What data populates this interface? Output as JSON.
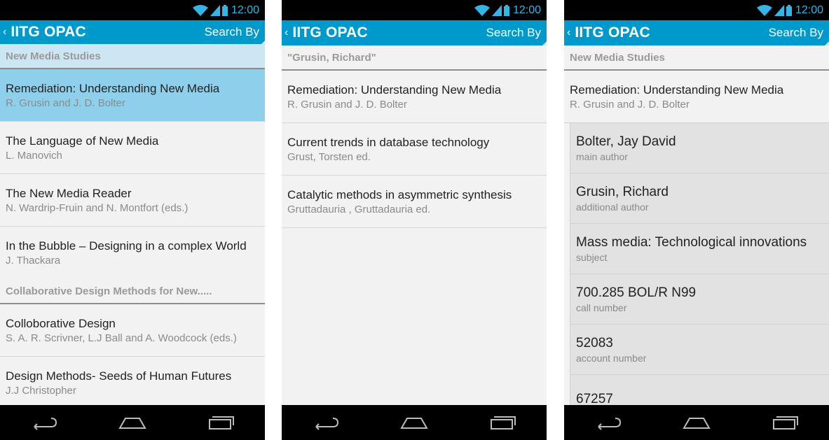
{
  "status": {
    "time": "12:00"
  },
  "colors": {
    "action_bar": "#0099cc",
    "status_icon": "#33b5e5",
    "selected": "#8ed0ec",
    "section_blue": "#cce7f3"
  },
  "icons": [
    "wifi-icon",
    "signal-icon",
    "battery-icon",
    "back-nav-icon",
    "home-nav-icon",
    "recents-nav-icon"
  ],
  "screens": [
    {
      "app_title": "IITG OPAC",
      "search_label": "Search By",
      "up_glyph": "‹",
      "sections": [
        {
          "header": "New Media Studies",
          "items": [
            {
              "title": "Remediation: Understanding New Media",
              "subtitle": "R. Grusin and J. D. Bolter"
            },
            {
              "title": "The Language of New Media",
              "subtitle": "L. Manovich"
            },
            {
              "title": "The New Media Reader",
              "subtitle": "N. Wardrip-Fruin and N. Montfort (eds.)"
            },
            {
              "title": "In the Bubble – Designing in a complex World",
              "subtitle": "J. Thackara"
            }
          ]
        },
        {
          "header": "Collaborative Design Methods for New.....",
          "items": [
            {
              "title": "Colloborative Design",
              "subtitle": "S. A. R. Scrivner, L.J Ball and A. Woodcock (eds.)"
            },
            {
              "title": "Design Methods- Seeds of Human Futures",
              "subtitle": "J.J Christopher"
            }
          ]
        }
      ]
    },
    {
      "app_title": "IITG OPAC",
      "search_label": "Search By",
      "up_glyph": "‹",
      "header": "\"Grusin, Richard\"",
      "items": [
        {
          "title": "Remediation: Understanding New Media",
          "subtitle": "R. Grusin and J. D. Bolter"
        },
        {
          "title": "Current trends in database technology",
          "subtitle": "Grust, Torsten ed."
        },
        {
          "title": "Catalytic methods in asymmetric synthesis",
          "subtitle": "Gruttadauria , Gruttadauria ed."
        }
      ]
    },
    {
      "app_title": "IITG OPAC",
      "search_label": "Search By",
      "up_glyph": "‹",
      "header": "New Media Studies",
      "book": {
        "title": "Remediation: Understanding New Media",
        "subtitle": "R. Grusin and J. D. Bolter"
      },
      "details": [
        {
          "value": "Bolter, Jay David",
          "label": "main author"
        },
        {
          "value": "Grusin, Richard",
          "label": "additional author"
        },
        {
          "value": "Mass media: Technological innovations",
          "label": "subject"
        },
        {
          "value": "700.285 BOL/R N99",
          "label": "call number"
        },
        {
          "value": "52083",
          "label": "account number"
        },
        {
          "value": "67257",
          "label": ""
        }
      ]
    }
  ]
}
